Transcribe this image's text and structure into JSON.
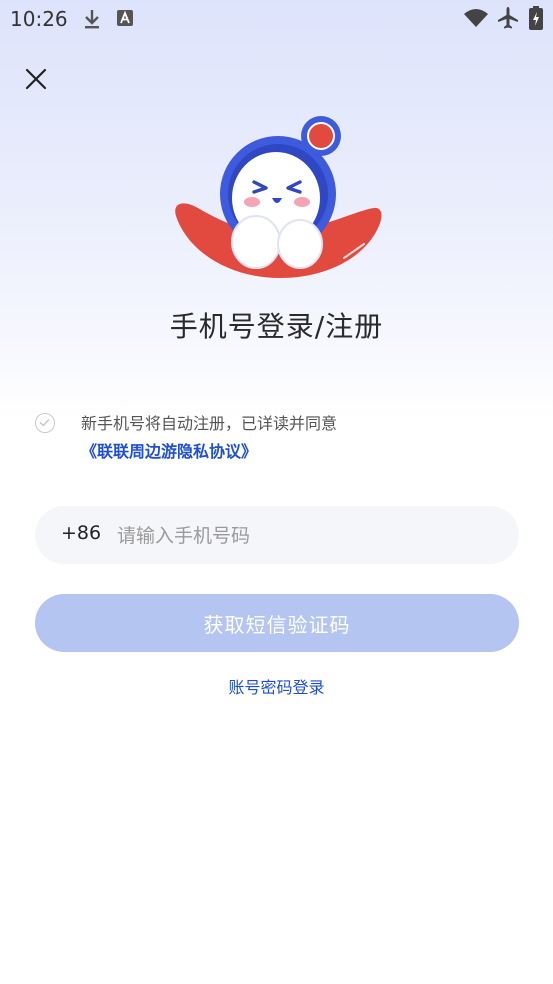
{
  "status_bar": {
    "time": "10:26",
    "icons": [
      "download-icon",
      "font-a-icon",
      "wifi-icon",
      "airplane-icon",
      "battery-charging-icon"
    ]
  },
  "header": {
    "close_icon": "close-icon"
  },
  "title": "手机号登录/注册",
  "agreement": {
    "text": "新手机号将自动注册，已详读并同意",
    "link": "《联联周边游隐私协议》",
    "checked": false
  },
  "phone": {
    "country_code": "+86",
    "placeholder": "请输入手机号码",
    "value": ""
  },
  "buttons": {
    "get_code": "获取短信验证码",
    "password_login": "账号密码登录"
  },
  "colors": {
    "accent": "#1f4fd6",
    "button_disabled": "#b5c5f2",
    "mascot_red": "#e34a3f",
    "mascot_blue": "#3d5bdc"
  }
}
